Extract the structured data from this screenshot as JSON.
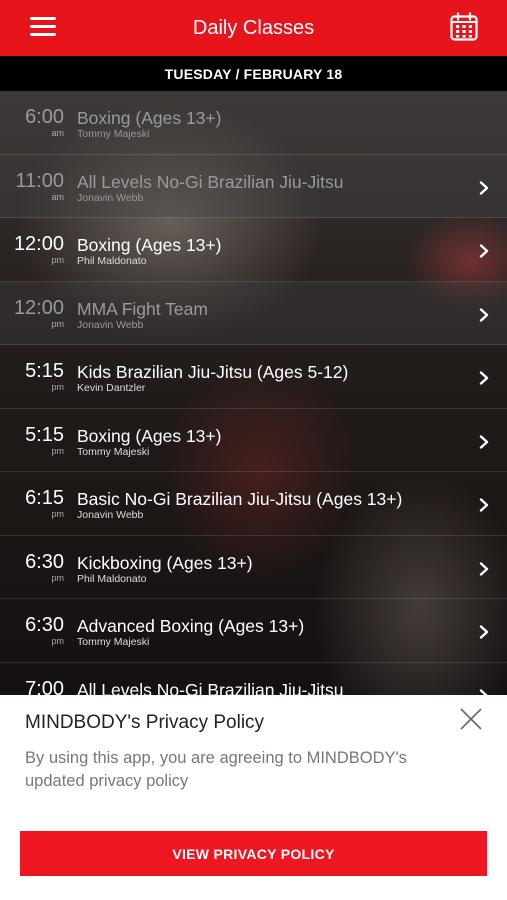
{
  "header": {
    "title": "Daily Classes"
  },
  "date_label": "TUESDAY / FEBRUARY 18",
  "classes": [
    {
      "time": "6:00",
      "ampm": "am",
      "name": "Boxing (Ages 13+)",
      "instructor": "Tommy Majeski",
      "dim": true,
      "chevron": false
    },
    {
      "time": "11:00",
      "ampm": "am",
      "name": "All Levels No-Gi Brazilian Jiu-Jitsu",
      "instructor": "Jonavin Webb",
      "dim": true,
      "chevron": true
    },
    {
      "time": "12:00",
      "ampm": "pm",
      "name": "Boxing (Ages 13+)",
      "instructor": "Phil Maldonato",
      "dim": false,
      "chevron": true
    },
    {
      "time": "12:00",
      "ampm": "pm",
      "name": "MMA Fight Team",
      "instructor": "Jonavin Webb",
      "dim": true,
      "chevron": true
    },
    {
      "time": "5:15",
      "ampm": "pm",
      "name": "Kids Brazilian Jiu-Jitsu (Ages 5-12)",
      "instructor": "Kevin Dantzler",
      "dim": false,
      "chevron": true
    },
    {
      "time": "5:15",
      "ampm": "pm",
      "name": "Boxing (Ages 13+)",
      "instructor": "Tommy Majeski",
      "dim": false,
      "chevron": true
    },
    {
      "time": "6:15",
      "ampm": "pm",
      "name": "Basic No-Gi Brazilian Jiu-Jitsu (Ages 13+)",
      "instructor": "Jonavin Webb",
      "dim": false,
      "chevron": true
    },
    {
      "time": "6:30",
      "ampm": "pm",
      "name": "Kickboxing (Ages 13+)",
      "instructor": "Phil Maldonato",
      "dim": false,
      "chevron": true
    },
    {
      "time": "6:30",
      "ampm": "pm",
      "name": "Advanced Boxing (Ages 13+)",
      "instructor": "Tommy Majeski",
      "dim": false,
      "chevron": true
    },
    {
      "time": "7:00",
      "ampm": "",
      "name": "All Levels No-Gi Brazilian Jiu-Jitsu",
      "instructor": "",
      "dim": false,
      "chevron": true
    }
  ],
  "privacy": {
    "title": "MINDBODY's Privacy Policy",
    "body": "By using this app, you are agreeing to MINDBODY's updated privacy policy",
    "button_label": "VIEW PRIVACY POLICY"
  },
  "icons": {
    "menu": "hamburger-icon",
    "calendar": "calendar-icon",
    "close": "close-icon",
    "chevron": "chevron-right-icon"
  },
  "colors": {
    "brand_red": "#e8141b",
    "button_red": "#ee1620"
  }
}
